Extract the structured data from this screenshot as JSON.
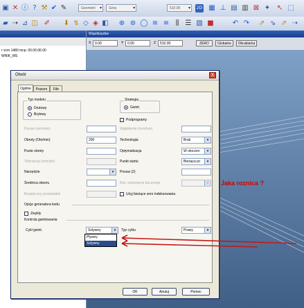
{
  "toolbar": {
    "select_geometry": "Geometri",
    "select_view": "Góra",
    "select_value": "510.00",
    "btn_2d": "2D"
  },
  "left_panel": {
    "line1": "r vcm 1480 mcp: 00.00.06.00",
    "line2": "WNIK_MS"
  },
  "right_panel": {
    "header": "Współrzędne",
    "x_label": "X",
    "x_value": "0.00",
    "y_label": "Y",
    "y_value": "0.00",
    "z_label": "Z",
    "z_value": "510.00",
    "btn_zero": "ZERO",
    "btn_global": "Globalne",
    "btn_local": "Obrabiarka"
  },
  "dialog": {
    "title": "Otwór",
    "close_label": "X",
    "tabs": [
      "Ogólne",
      "Poziom",
      "Filtr"
    ],
    "group_model": "Typ modelu",
    "radio_linear": "Drutowy",
    "radio_bryl": "Bryłowy",
    "group_strategy": "Strategia",
    "radio_gwint": "Gwint.",
    "chk_podprogramy": "Podprogramy",
    "posuw_label": "Posuw (mm/min)",
    "wglebienie_label": "Wgłębienie (mm/min)",
    "obroty_label": "Obroty (Obr/min)",
    "obroty_value": "200",
    "technologia_label": "Technologia",
    "technologia_value": "Brak",
    "puste_obroty_label": "Puste obroty",
    "optymalizacja_label": "Optymalizacja",
    "optymalizacja_value": "W otoczen",
    "tolerancja_label": "Tolerancja (mm/obr)",
    "punkt_startu_label": "Punkt startu",
    "punkt_startu_value": "Bieżąca pc",
    "narzedzie_label": "Narzędzie",
    "posuw2_label": "Posuw (2)",
    "srednica_label": "Średnica otworu",
    "kier_label": "Kier. odsunięcia bocznego",
    "bezpieczny_label": "Bezpieczny przedziałek",
    "chk_zero_label": "Użyj bieżące zero indeksowania",
    "opcje_label": "Opcje generatora kodu",
    "chk_zwykly": "Zwykły",
    "kontrola_label": "Kontrola gwintowania",
    "cykl_label": "Cykl gwint.",
    "cykl_value": "Sztywny",
    "typ_cyklu_label": "Typ cyklu",
    "typ_cyklu_value": "Prawy",
    "dropdown_options": [
      "Pływny",
      "Sztywny"
    ],
    "btn_ok": "OK",
    "btn_cancel": "Anuluj",
    "btn_help": "Pomoc"
  },
  "annotation": "Jaka roznica ?",
  "colors": {
    "annotation": "#d10000",
    "arrow": "#c41818",
    "selected_item": "#2a4b8e"
  }
}
